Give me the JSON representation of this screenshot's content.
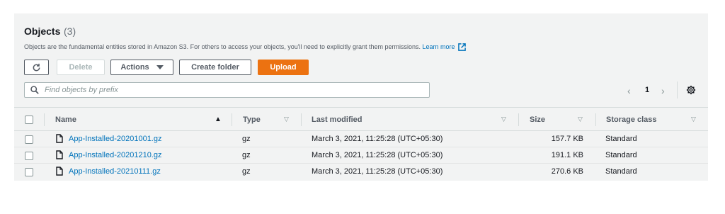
{
  "header": {
    "title": "Objects",
    "count": "(3)",
    "description": "Objects are the fundamental entities stored in Amazon S3. For others to access your objects, you'll need to explicitly grant them permissions.",
    "learn_more": "Learn more"
  },
  "toolbar": {
    "refresh_icon": "refresh-icon",
    "delete_label": "Delete",
    "actions_label": "Actions",
    "create_folder_label": "Create folder",
    "upload_label": "Upload"
  },
  "search": {
    "placeholder": "Find objects by prefix",
    "value": ""
  },
  "pagination": {
    "prev": "‹",
    "current": "1",
    "next": "›"
  },
  "table": {
    "columns": {
      "name": "Name",
      "type": "Type",
      "last_modified": "Last modified",
      "size": "Size",
      "storage_class": "Storage class"
    },
    "rows": [
      {
        "name": "App-Installed-20201001.gz",
        "type": "gz",
        "last_modified": "March 3, 2021, 11:25:28 (UTC+05:30)",
        "size": "157.7 KB",
        "storage_class": "Standard"
      },
      {
        "name": "App-Installed-20201210.gz",
        "type": "gz",
        "last_modified": "March 3, 2021, 11:25:28 (UTC+05:30)",
        "size": "191.1 KB",
        "storage_class": "Standard"
      },
      {
        "name": "App-Installed-20210111.gz",
        "type": "gz",
        "last_modified": "March 3, 2021, 11:25:28 (UTC+05:30)",
        "size": "270.6 KB",
        "storage_class": "Standard"
      }
    ]
  },
  "colors": {
    "accent": "#ec7211",
    "link": "#0073bb",
    "panel_bg": "#f2f3f3"
  }
}
